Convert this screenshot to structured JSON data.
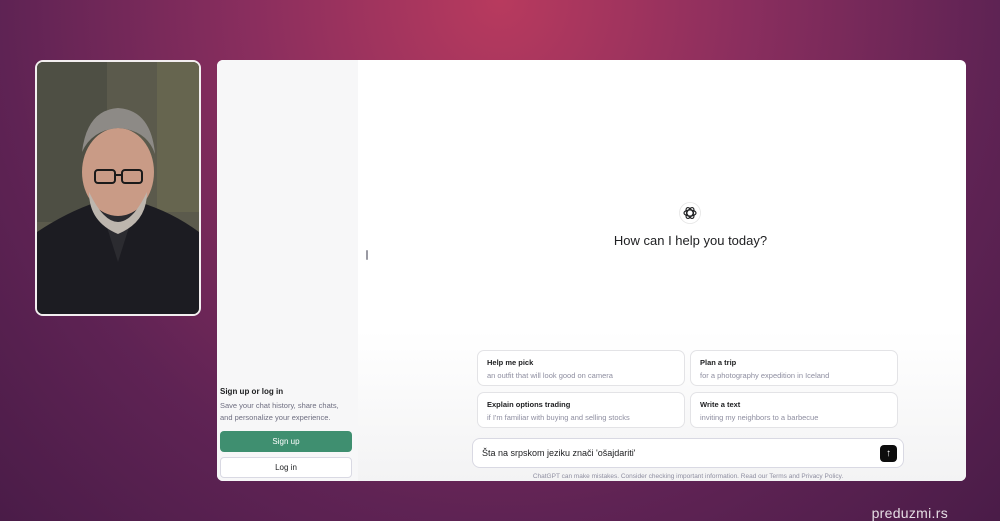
{
  "sidebar": {
    "signup_title": "Sign up or log in",
    "signup_desc": "Save your chat history, share chats, and personalize your experience.",
    "signup_button": "Sign up",
    "login_button": "Log in"
  },
  "main": {
    "logo_icon": "openai-logo-icon",
    "headline": "How can I help you today?",
    "suggestions": [
      {
        "title": "Help me pick",
        "subtitle": "an outfit that will look good on camera"
      },
      {
        "title": "Plan a trip",
        "subtitle": "for a photography expedition in Iceland"
      },
      {
        "title": "Explain options trading",
        "subtitle": "if I'm familiar with buying and selling stocks"
      },
      {
        "title": "Write a text",
        "subtitle": "inviting my neighbors to a barbecue"
      }
    ],
    "input_value": "Šta na srpskom jeziku znači 'ošajdariti'",
    "send_icon": "arrow-up-icon",
    "disclaimer": "ChatGPT can make mistakes. Consider checking important information. Read our Terms and Privacy Policy."
  },
  "overlay": {
    "watermark": "preduzmi.rs"
  },
  "colors": {
    "accent_green": "#3f8f70",
    "background_magenta": "#8a2e5e"
  }
}
